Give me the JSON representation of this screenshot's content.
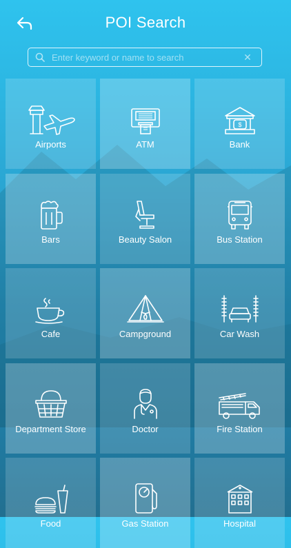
{
  "header": {
    "title": "POI Search"
  },
  "search": {
    "placeholder": "Enter keyword or name to search"
  },
  "categories": [
    {
      "label": "Airports",
      "icon": "airport-icon"
    },
    {
      "label": "ATM",
      "icon": "atm-icon"
    },
    {
      "label": "Bank",
      "icon": "bank-icon"
    },
    {
      "label": "Bars",
      "icon": "beer-mug-icon"
    },
    {
      "label": "Beauty Salon",
      "icon": "salon-chair-icon"
    },
    {
      "label": "Bus Station",
      "icon": "bus-icon"
    },
    {
      "label": "Cafe",
      "icon": "coffee-cup-icon"
    },
    {
      "label": "Campground",
      "icon": "tent-icon"
    },
    {
      "label": "Car Wash",
      "icon": "car-wash-icon"
    },
    {
      "label": "Department Store",
      "icon": "shopping-basket-icon"
    },
    {
      "label": "Doctor",
      "icon": "doctor-icon"
    },
    {
      "label": "Fire Station",
      "icon": "fire-truck-icon"
    },
    {
      "label": "Food",
      "icon": "burger-drink-icon"
    },
    {
      "label": "Gas Station",
      "icon": "fuel-pump-icon"
    },
    {
      "label": "Hospital",
      "icon": "hospital-building-icon"
    }
  ]
}
